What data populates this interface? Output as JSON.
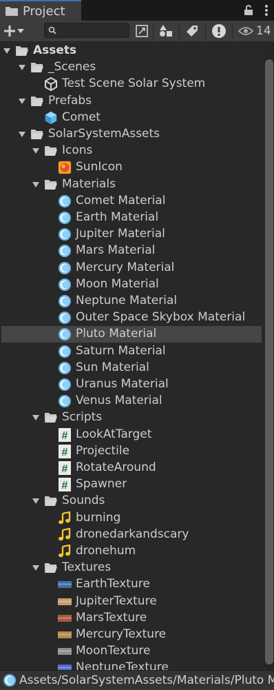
{
  "tab": {
    "title": "Project",
    "icon": "folder-icon"
  },
  "toolbar": {
    "search_placeholder": "",
    "hidden_count": "14"
  },
  "tree": [
    {
      "label": "Assets",
      "bold": true,
      "icon": "folder-open",
      "depth": 0,
      "expanded": true
    },
    {
      "label": "_Scenes",
      "icon": "folder-open",
      "depth": 1,
      "expanded": true
    },
    {
      "label": "Test Scene Solar System",
      "icon": "unity-scene",
      "depth": 2
    },
    {
      "label": "Prefabs",
      "icon": "folder-open",
      "depth": 1,
      "expanded": true
    },
    {
      "label": "Comet",
      "icon": "prefab",
      "depth": 2
    },
    {
      "label": "SolarSystemAssets",
      "icon": "folder-open",
      "depth": 1,
      "expanded": true
    },
    {
      "label": "Icons",
      "icon": "folder-open",
      "depth": 2,
      "expanded": true
    },
    {
      "label": "SunIcon",
      "icon": "sun-texture",
      "depth": 3
    },
    {
      "label": "Materials",
      "icon": "folder-open",
      "depth": 2,
      "expanded": true
    },
    {
      "label": "Comet Material",
      "icon": "material",
      "depth": 3
    },
    {
      "label": "Earth Material",
      "icon": "material",
      "depth": 3
    },
    {
      "label": "Jupiter Material",
      "icon": "material",
      "depth": 3
    },
    {
      "label": "Mars Material",
      "icon": "material",
      "depth": 3
    },
    {
      "label": "Mercury Material",
      "icon": "material",
      "depth": 3
    },
    {
      "label": "Moon Material",
      "icon": "material",
      "depth": 3
    },
    {
      "label": "Neptune Material",
      "icon": "material",
      "depth": 3
    },
    {
      "label": "Outer Space Skybox Material",
      "icon": "material",
      "depth": 3
    },
    {
      "label": "Pluto Material",
      "icon": "material",
      "depth": 3,
      "selected": true
    },
    {
      "label": "Saturn Material",
      "icon": "material",
      "depth": 3
    },
    {
      "label": "Sun Material",
      "icon": "material",
      "depth": 3
    },
    {
      "label": "Uranus Material",
      "icon": "material",
      "depth": 3
    },
    {
      "label": "Venus Material",
      "icon": "material",
      "depth": 3
    },
    {
      "label": "Scripts",
      "icon": "folder-open",
      "depth": 2,
      "expanded": true
    },
    {
      "label": "LookAtTarget",
      "icon": "csharp-script",
      "depth": 3
    },
    {
      "label": "Projectile",
      "icon": "csharp-script",
      "depth": 3
    },
    {
      "label": "RotateAround",
      "icon": "csharp-script",
      "depth": 3
    },
    {
      "label": "Spawner",
      "icon": "csharp-script",
      "depth": 3
    },
    {
      "label": "Sounds",
      "icon": "folder-open",
      "depth": 2,
      "expanded": true
    },
    {
      "label": "burning",
      "icon": "audio",
      "depth": 3
    },
    {
      "label": "dronedarkandscary",
      "icon": "audio",
      "depth": 3
    },
    {
      "label": "dronehum",
      "icon": "audio",
      "depth": 3
    },
    {
      "label": "Textures",
      "icon": "folder-open",
      "depth": 2,
      "expanded": true
    },
    {
      "label": "EarthTexture",
      "icon": "texture",
      "depth": 3,
      "color": "#3d6fa8"
    },
    {
      "label": "JupiterTexture",
      "icon": "texture",
      "depth": 3,
      "color": "#c99a6a"
    },
    {
      "label": "MarsTexture",
      "icon": "texture",
      "depth": 3,
      "color": "#a9583c"
    },
    {
      "label": "MercuryTexture",
      "icon": "texture",
      "depth": 3,
      "color": "#b58a52"
    },
    {
      "label": "MoonTexture",
      "icon": "texture",
      "depth": 3,
      "color": "#8d8d8d"
    },
    {
      "label": "NeptuneTexture",
      "icon": "texture",
      "depth": 3,
      "color": "#4a6ad0"
    }
  ],
  "status": {
    "path": "Assets/SolarSystemAssets/Materials/Pluto Material.mat",
    "icon": "material"
  },
  "colors": {
    "selected_row": "#464646",
    "material_blue": "#7fc6f0",
    "audio_yellow": "#f2c230",
    "tab_accent": "#3a72b0"
  }
}
